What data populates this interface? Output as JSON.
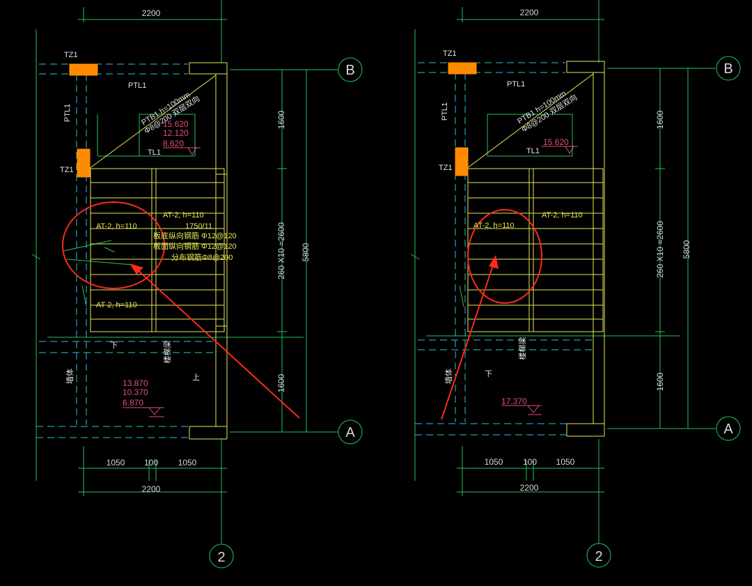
{
  "colors": {
    "background": "#000000",
    "grid_line": "#22c55e",
    "wall_yellow": "#e8e858",
    "beam_cyan": "#26c6da",
    "column_orange": "#ff8c00",
    "elevation_pink": "#e0507a",
    "annotation_red": "#ff2a1a"
  },
  "left_plan": {
    "dim_top": "2200",
    "dim_bottom_segments": [
      "1050",
      "100",
      "1050"
    ],
    "dim_bottom_total": "2200",
    "dim_right_top": "1600",
    "dim_right_middle": "260 X10 =2600",
    "dim_right_bottom": "1600",
    "dim_right_total": "5800",
    "axis_b": "B",
    "axis_a": "A",
    "axis_2": "2",
    "tz1_top": "TZ1",
    "tz1_mid": "TZ1",
    "ptl1_top": "PTL1",
    "ptl1_side": "PTL1",
    "tl1": "TL1",
    "ptb_line1": "PTB1  h=100mm",
    "ptb_line2": "Φ8@200 双层双向",
    "elev_upper": [
      "15.620",
      "12.120",
      "8.620"
    ],
    "flight_left": "AT-2, h=110",
    "flight_right": "AT-2, h=110",
    "flight_lower": "AT-2, h=110",
    "rebar_span": "1750/11",
    "rebar_line1": "板底纵向钢筋 Φ12@120",
    "rebar_line2": "板面纵向钢筋 Φ12@120",
    "rebar_line3": "分布钢筋Φ8@200",
    "down_label": "下",
    "up_label": "上",
    "landing_label": "楼梯梁",
    "wall_label": "墙体",
    "elev_lower": [
      "13.870",
      "10.370",
      "6.870"
    ]
  },
  "right_plan": {
    "dim_top": "2200",
    "dim_bottom_segments": [
      "1050",
      "100",
      "1050"
    ],
    "dim_bottom_total": "2200",
    "dim_right_top": "1600",
    "dim_right_middle": "260 X10 =2600",
    "dim_right_bottom": "1600",
    "dim_right_total": "5800",
    "axis_b": "B",
    "axis_a": "A",
    "axis_2": "2",
    "tz1_top": "TZ1",
    "tz1_mid": "TZ1",
    "ptl1_top": "PTL1",
    "ptl1_side": "PTL1",
    "tl1": "TL1",
    "ptb_line1": "PTB1  h=100mm",
    "ptb_line2": "Φ8@200 双层双向",
    "elev_upper": "15.620",
    "flight_left": "AT-2, h=110",
    "flight_right": "AT-2, h=110",
    "down_label": "下",
    "landing_label": "楼梯梁",
    "wall_label": "墙体",
    "elev_lower": "17.370"
  }
}
